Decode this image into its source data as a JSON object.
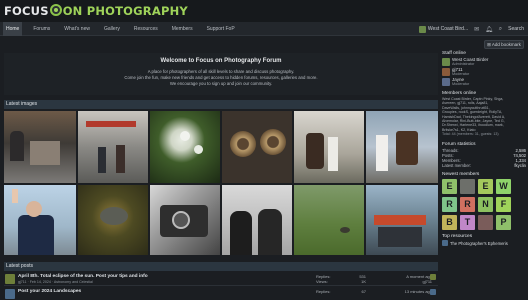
{
  "header": {
    "logo_left": "FOCUS",
    "logo_right": "ON PHOTOGRAPHY"
  },
  "nav": {
    "items": [
      "Home",
      "Forums",
      "What's new",
      "Gallery",
      "Resources",
      "Members",
      "Support FoP"
    ],
    "user_name": "West Coast Bird...",
    "search_label": "Search"
  },
  "bookmark_label": "Add bookmark",
  "welcome": {
    "title": "Welcome to Focus on Photography Forum",
    "line1": "A place for photographers of all skill levels to share and discuss photography.",
    "line2": "Come join the fun, make new friends and get access to hidden forums, resources, galleries and more.",
    "line3": "We encourage you to sign up and join our community."
  },
  "latest_images_label": "Latest images",
  "latest_posts_label": "Latest posts",
  "posts": [
    {
      "title": "April 8th. Total eclipse of the sun. Post your tips and info",
      "meta": "gj711 · Feb 14, 2024 · Astronomy and Celestial",
      "replies_label": "Replies:",
      "replies": "531",
      "views_label": "Views:",
      "views": "1K",
      "time": "A moment ago",
      "user": "gj711",
      "color": "#6e7f3a"
    },
    {
      "title": "Post your 2024 Landscapes",
      "meta": "",
      "replies_label": "Replies:",
      "replies": "67",
      "views_label": "",
      "views": "",
      "time": "13 minutes ago",
      "user": "",
      "color": "#4a6a8a"
    }
  ],
  "sidebar": {
    "staff_title": "Staff online",
    "staff": [
      {
        "name": "West Coast Birder",
        "role": "Administrator",
        "color": "#6b8a4a"
      },
      {
        "name": "gj711",
        "role": "Moderator",
        "color": "#8a5a3a"
      },
      {
        "name": "Jayne",
        "role": "Moderator",
        "color": "#5a6a8a"
      }
    ],
    "members_title": "Members online",
    "members_lines": [
      "West Coast Birder, Captn Pinky, Shga,",
      "Avereen, gj711, rolls, Aaja81,",
      "DaveWalls, johnnycutthrutt51,",
      "Groupies, rookS, guerdeight, RollyTA,",
      "HamishDad, ThekingofAverett, David A,",
      "Alvemolar, Rini-Butt-bite, Jayne, Ted G,",
      "Dr.Sherwi, Harlene33, ihoodlum, mark,",
      "Britske7s1, K2, Ktato"
    ],
    "members_total": "Total: 44 (members: 31, guests: 13)",
    "stats_title": "Forum statistics",
    "stats": [
      {
        "label": "Threads:",
        "value": "2,586"
      },
      {
        "label": "Posts:",
        "value": "74,502"
      },
      {
        "label": "Members:",
        "value": "1,334"
      },
      {
        "label": "Latest member:",
        "value": "fkyclin"
      }
    ],
    "newest_title": "Newest members",
    "newest": [
      {
        "letter": "E",
        "color": "#8fc06a"
      },
      {
        "letter": "",
        "color": "#6d6f6a"
      },
      {
        "letter": "E",
        "color": "#a4c85c"
      },
      {
        "letter": "W",
        "color": "#8fd36a"
      },
      {
        "letter": "R",
        "color": "#7fc48a"
      },
      {
        "letter": "R",
        "color": "#d07060"
      },
      {
        "letter": "N",
        "color": "#8cc060"
      },
      {
        "letter": "F",
        "color": "#9fd35a"
      },
      {
        "letter": "B",
        "color": "#c0b45a"
      },
      {
        "letter": "T",
        "color": "#c087c8"
      },
      {
        "letter": "",
        "color": "#7a5c5a"
      },
      {
        "letter": "P",
        "color": "#8fc06a"
      }
    ],
    "resources_title": "Top resources",
    "resource_item": "The Photographer's Ephemeris"
  }
}
